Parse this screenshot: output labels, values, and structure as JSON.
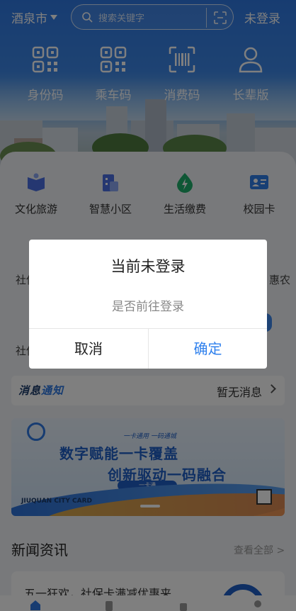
{
  "header": {
    "city": "酒泉市",
    "search_placeholder": "搜索关键字",
    "login_label": "未登录"
  },
  "quick_actions": [
    {
      "label": "身份码",
      "icon": "qr-code-icon"
    },
    {
      "label": "乘车码",
      "icon": "qr-code-icon"
    },
    {
      "label": "消费码",
      "icon": "barcode-scan-icon"
    },
    {
      "label": "长辈版",
      "icon": "person-icon"
    }
  ],
  "services": [
    {
      "label": "文化旅游",
      "icon": "book-icon",
      "color": "#4a6fe3"
    },
    {
      "label": "智慧小区",
      "icon": "building-icon",
      "color": "#4a6fe3"
    },
    {
      "label": "生活缴费",
      "icon": "lightning-drop-icon",
      "color": "#1fae6a"
    },
    {
      "label": "校园卡",
      "icon": "id-card-icon",
      "color": "#2f7fe8"
    }
  ],
  "peek_labels": {
    "row2_left": "社保",
    "row2_right": "惠农",
    "row3_left": "社保",
    "row3_right": ""
  },
  "notice": {
    "brand_a": "消息",
    "brand_b": "通知",
    "message": "暂无消息"
  },
  "banner": {
    "line1": "数字赋能一卡覆盖",
    "line2": "创新驱动一码融合",
    "small": "一卡通用 一码通城",
    "pill": "一卡通",
    "corner": "JIUQUAN CITY CARD"
  },
  "news": {
    "title": "新闻资讯",
    "more": "查看全部 >",
    "item": "五一狂欢，社保卡满减优惠来"
  },
  "dialog": {
    "title": "当前未登录",
    "message": "是否前往登录",
    "cancel": "取消",
    "confirm": "确定"
  },
  "colors": {
    "primary": "#2f79e3",
    "confirm": "#2f80ed",
    "overlay": "rgba(0,0,0,0.5)"
  }
}
